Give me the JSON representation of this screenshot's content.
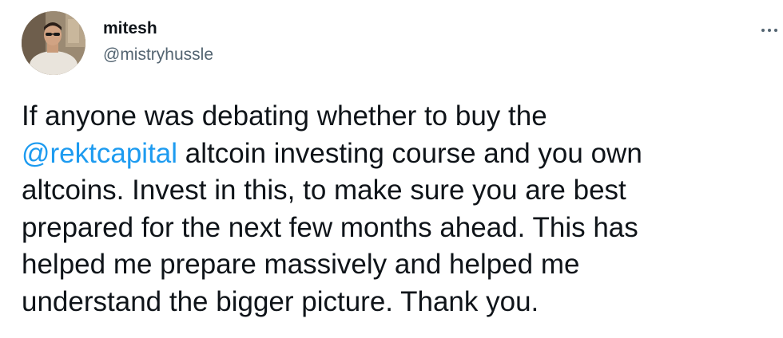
{
  "tweet": {
    "author": {
      "display_name": "mitesh",
      "handle": "@mistryhussle"
    },
    "more_icon": "more-horizontal-icon",
    "text_lines": [
      {
        "before": "If anyone was debating whether to buy the",
        "mention": "",
        "after": ""
      },
      {
        "before": "",
        "mention": "@rektcapital",
        "after": " altcoin investing course and you own"
      },
      {
        "before": "altcoins. Invest in this, to make sure you are best",
        "mention": "",
        "after": ""
      },
      {
        "before": "prepared for the next few months ahead. This has",
        "mention": "",
        "after": ""
      },
      {
        "before": "helped me prepare massively and helped me",
        "mention": "",
        "after": ""
      },
      {
        "before": "understand the bigger picture. Thank you.",
        "mention": "",
        "after": ""
      }
    ],
    "colors": {
      "text": "#0f1419",
      "secondary": "#536471",
      "link": "#1d9bf0"
    }
  }
}
